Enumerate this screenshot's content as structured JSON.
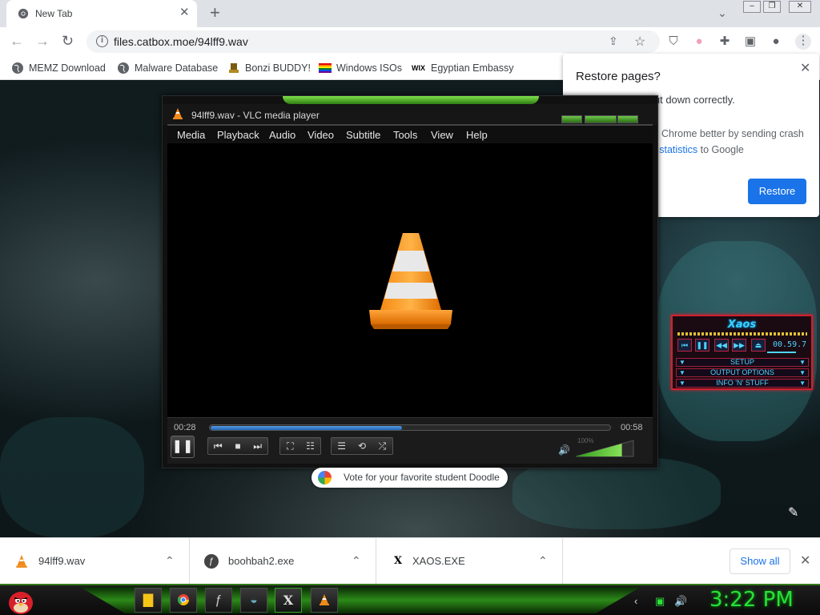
{
  "browser": {
    "tab": {
      "title": "New Tab"
    },
    "url": "files.catbox.moe/94lff9.wav",
    "bookmarks": [
      {
        "label": "MEMZ Download",
        "icon": "globe-icon"
      },
      {
        "label": "Malware Database",
        "icon": "globe-icon"
      },
      {
        "label": "Bonzi BUDDY!",
        "icon": "bonzi-icon"
      },
      {
        "label": "Windows ISOs",
        "icon": "rainbow-flag-icon"
      },
      {
        "label": "Egyptian Embassy",
        "icon": "wix-icon"
      }
    ],
    "restore_bubble": {
      "title": "Restore pages?",
      "message": "Chrome didn't shut down correctly.",
      "help_prefix": "Help make Google Chrome better by sending crash reports and ",
      "help_link": "usage statistics",
      "help_suffix": " to Google",
      "button": "Restore"
    },
    "doodle": "Vote for your favorite student Doodle"
  },
  "vlc": {
    "title": "94lff9.wav - VLC media player",
    "menu": [
      "Media",
      "Playback",
      "Audio",
      "Video",
      "Subtitle",
      "Tools",
      "View",
      "Help"
    ],
    "time_elapsed": "00:28",
    "time_total": "00:58",
    "progress_fraction": 0.48,
    "volume_label": "100%",
    "volume_fraction": 0.8
  },
  "xaos": {
    "title": "Xaos",
    "time": "00.59.7",
    "rows": [
      "SETUP",
      "OUTPUT OPTIONS",
      "INFO 'N' STUFF"
    ]
  },
  "downloads": {
    "items": [
      {
        "name": "94lff9.wav",
        "icon": "vlc-cone-icon"
      },
      {
        "name": "boohbah2.exe",
        "icon": "flash-icon"
      },
      {
        "name": "XAOS.EXE",
        "icon": "xaos-icon"
      }
    ],
    "show_all": "Show all"
  },
  "taskbar": {
    "clock": "3:22 PM",
    "apps": [
      "folder-icon",
      "chrome-icon",
      "flash-icon",
      "bird-icon",
      "xaos-icon",
      "vlc-cone-icon"
    ]
  },
  "colors": {
    "accent": "#1a73e8",
    "vlc_green": "#2d7c12",
    "xaos_red": "#d1202e",
    "clock_green": "#27e03a"
  }
}
